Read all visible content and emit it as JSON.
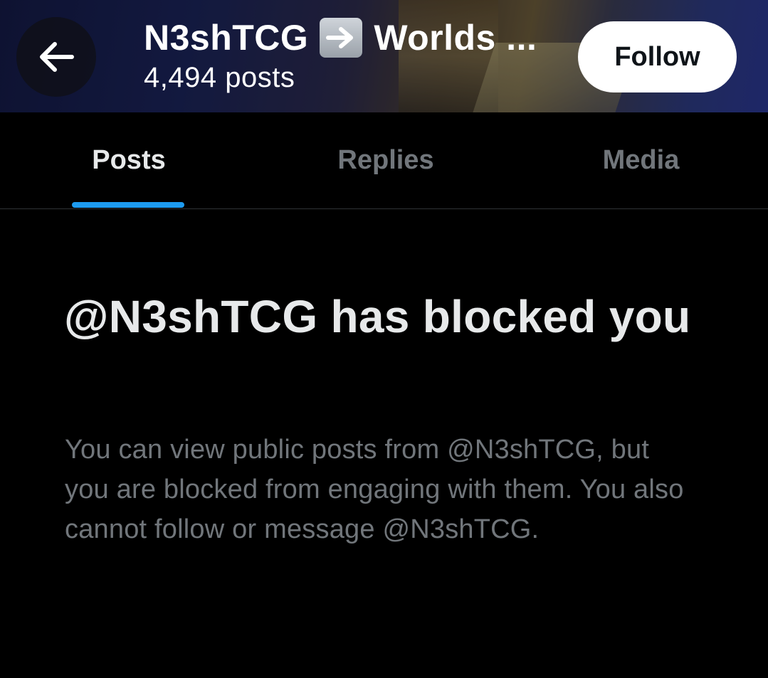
{
  "header": {
    "profile_name_prefix": "N3shTCG",
    "profile_name_suffix": "Worlds ...",
    "name_emoji": "right-arrow-emoji",
    "post_count": "4,494 posts",
    "follow_label": "Follow",
    "back_icon": "arrow-left-icon"
  },
  "tabs": [
    {
      "label": "Posts",
      "active": true
    },
    {
      "label": "Replies",
      "active": false
    },
    {
      "label": "Media",
      "active": false
    }
  ],
  "blocked": {
    "heading": "@N3shTCG has blocked you",
    "description": "You can view public posts from @N3shTCG, but you are blocked from engaging with them. You also cannot follow or message @N3shTCG."
  },
  "colors": {
    "background": "#000000",
    "accent": "#1d9bf0",
    "text_primary": "#e7e9ea",
    "text_secondary": "#71767b",
    "divider": "#2f3336"
  }
}
